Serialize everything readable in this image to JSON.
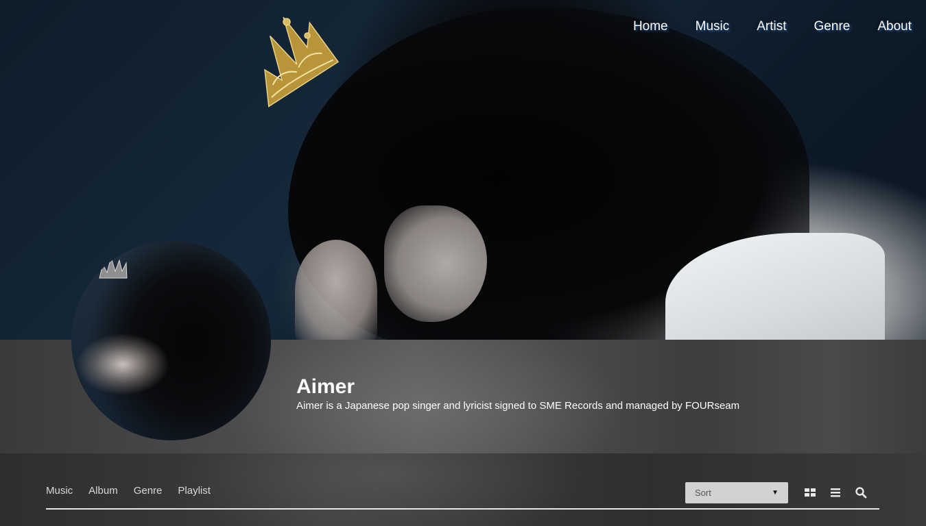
{
  "nav": {
    "items": [
      {
        "label": "Home"
      },
      {
        "label": "Music"
      },
      {
        "label": "Artist"
      },
      {
        "label": "Genre"
      },
      {
        "label": "About"
      }
    ]
  },
  "profile": {
    "name": "Aimer",
    "bio": "Aimer is a Japanese pop singer and lyricist signed to SME Records and managed by FOURseam"
  },
  "tabs": [
    {
      "label": "Music"
    },
    {
      "label": "Album"
    },
    {
      "label": "Genre"
    },
    {
      "label": "Playlist"
    }
  ],
  "toolbar": {
    "sort_label": "Sort",
    "icons": [
      "grid-view-icon",
      "list-view-icon",
      "search-icon"
    ]
  },
  "colors": {
    "nav_text": "#ffffff",
    "nav_shadow": "#2a5a9a",
    "divider": "#e6e6e6",
    "select_bg": "#d2d2d2"
  }
}
